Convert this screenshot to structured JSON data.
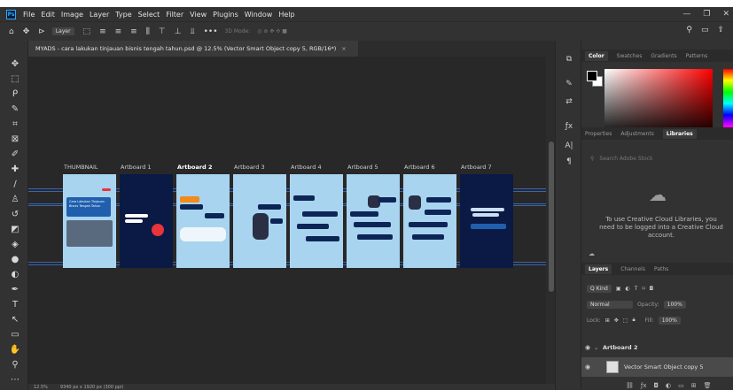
{
  "menu": [
    "File",
    "Edit",
    "Image",
    "Layer",
    "Type",
    "Select",
    "Filter",
    "View",
    "Plugins",
    "Window",
    "Help"
  ],
  "app_logo": "Ps",
  "window_controls": [
    "—",
    "❐",
    "✕"
  ],
  "options_bar": {
    "auto_select_target": "Layer",
    "mode_3d": "3D Mode:",
    "more": "•••"
  },
  "document": {
    "tab_title": "MYADS - cara lakukan tinjauan bisnis tengah tahun.psd @ 12.5% (Vector Smart Object copy 5, RGB/16*)",
    "close": "×"
  },
  "artboards": [
    "THUMBNAIL",
    "Artboard 1",
    "Artboard 2",
    "Artboard 3",
    "Artboard 4",
    "Artboard 5",
    "Artboard 6",
    "Artboard 7"
  ],
  "active_artboard": "Artboard 2",
  "thumbnail_text": "Cara Lakukan Tinjauan Bisnis Tengah Tahun",
  "status": {
    "zoom": "12.5%",
    "doc_size": "9340 px x 1920 px (300 ppi)"
  },
  "panels": {
    "color_tabs": [
      "Color",
      "Swatches",
      "Gradients",
      "Patterns"
    ],
    "props_tabs": [
      "Properties",
      "Adjustments",
      "Libraries"
    ],
    "libraries_search_placeholder": "Search Adobe Stock",
    "libraries_message": "To use Creative Cloud Libraries, you need to be logged into a Creative Cloud account.",
    "layers_tabs": [
      "Layers",
      "Channels",
      "Paths"
    ],
    "filter_kind": "Q Kind",
    "blend_mode": "Normal",
    "opacity_label": "Opacity:",
    "opacity_value": "100%",
    "lock_label": "Lock:",
    "fill_label": "Fill:",
    "fill_value": "100%",
    "layers": [
      {
        "name": "Artboard 2",
        "type": "group"
      },
      {
        "name": "Vector Smart Object copy 5",
        "type": "smart-object"
      }
    ]
  },
  "colors": {
    "accent": "#31a8ff",
    "panel_bg": "#323232",
    "canvas_bg": "#282828",
    "guide": "#3b6ec9"
  }
}
